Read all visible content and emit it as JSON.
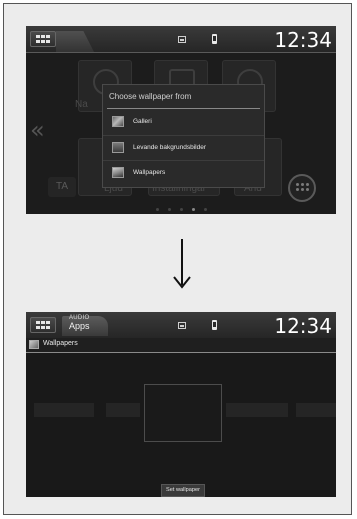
{
  "screen1": {
    "status": {
      "clock": "12:34"
    },
    "background": {
      "nav_label": "Na",
      "ta_label": "TA",
      "bottom_labels": [
        "Ljud",
        "Inställningar",
        "And"
      ]
    },
    "dialog": {
      "title": "Choose wallpaper from",
      "options": [
        {
          "label": "Galleri",
          "icon": "gallery-icon"
        },
        {
          "label": "Levande bakgrundsbilder",
          "icon": "live-wallpaper-icon"
        },
        {
          "label": "Wallpapers",
          "icon": "wallpapers-icon"
        }
      ]
    },
    "page_indicator": {
      "count": 5,
      "active": 4
    }
  },
  "screen2": {
    "status": {
      "audio_label": "AUDIO",
      "apps_label": "Apps",
      "clock": "12:34"
    },
    "title": "Wallpapers",
    "set_button": "Set wallpaper"
  },
  "colors": {
    "screen_bg": "#1c1c1c",
    "status_bg": "#2e2e2e",
    "text": "#ffffff",
    "frame": "#ececec"
  }
}
